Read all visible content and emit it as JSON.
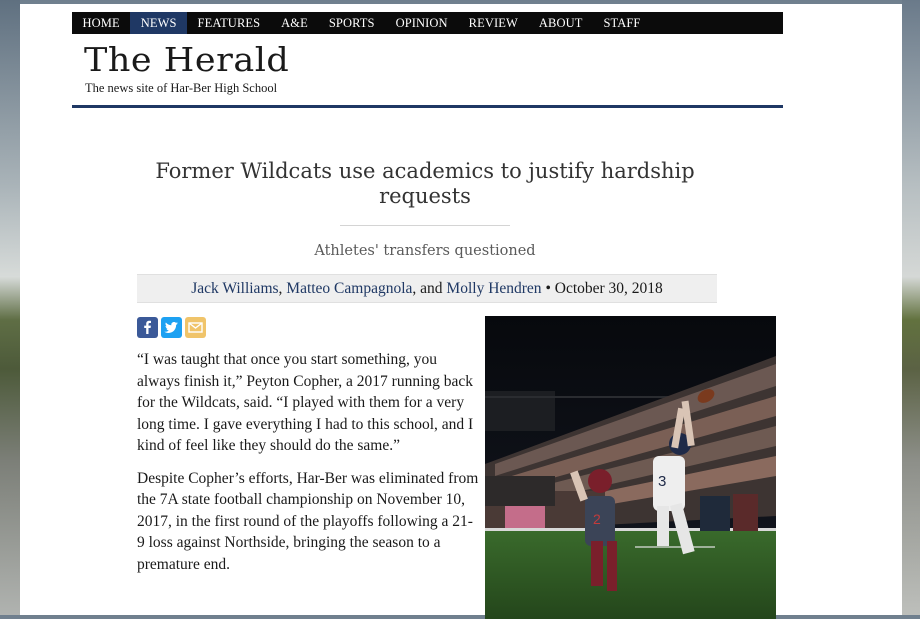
{
  "site": {
    "title": "The Herald",
    "tagline": "The news site of Har-Ber High School"
  },
  "nav": {
    "items": [
      {
        "label": "HOME",
        "active": false
      },
      {
        "label": "NEWS",
        "active": true
      },
      {
        "label": "FEATURES",
        "active": false
      },
      {
        "label": "A&E",
        "active": false
      },
      {
        "label": "SPORTS",
        "active": false
      },
      {
        "label": "OPINION",
        "active": false
      },
      {
        "label": "REVIEW",
        "active": false
      },
      {
        "label": "ABOUT",
        "active": false
      },
      {
        "label": "STAFF",
        "active": false
      }
    ]
  },
  "article": {
    "headline": "Former Wildcats use academics to justify hardship requests",
    "subheadline": "Athletes' transfers questioned",
    "authors": [
      "Jack Williams",
      "Matteo Campagnola",
      "Molly Hendren"
    ],
    "author_sep_1": ", ",
    "author_sep_2": ", and ",
    "date_sep": " • ",
    "date": "October 30, 2018",
    "paragraphs": [
      "“I was taught that once you start something, you always finish it,” Peyton Copher, a 2017 running back for the Wildcats, said. “I played with them for a very long time. I gave everything I had to this school, and I kind of feel like they should do the same.”",
      "Despite Copher’s efforts, Har-Ber was eliminated from the 7A state football championship on November 10, 2017, in the first round of the playoffs following a 21-9 loss against Northside, bringing the season to a premature end."
    ]
  },
  "share": {
    "icons": [
      "facebook-icon",
      "twitter-icon",
      "email-icon"
    ]
  },
  "colors": {
    "accent": "#1f3864",
    "nav_bg": "#0b0b0b",
    "facebook": "#3b5998",
    "twitter": "#1da1f2",
    "email": "#f0c46a"
  }
}
